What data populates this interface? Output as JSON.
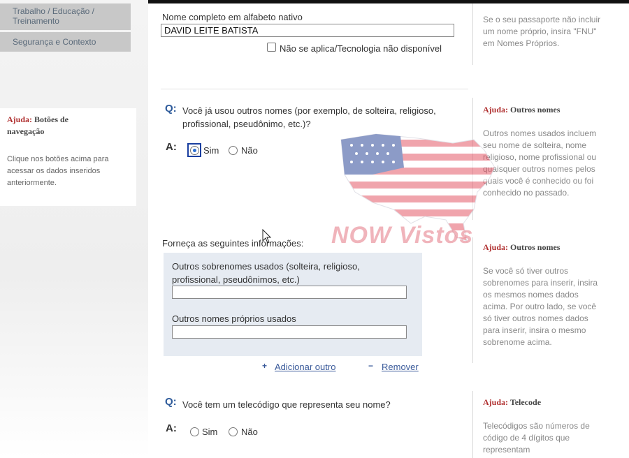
{
  "nav": {
    "items": [
      {
        "label": "Trabalho / Educação / Treinamento"
      },
      {
        "label": "Segurança e Contexto"
      }
    ]
  },
  "left_help": {
    "title_prefix": "Ajuda:",
    "title": "Botões de navegação",
    "text": "Clique nos botões acima para acessar os dados inseridos anteriormente."
  },
  "native_name": {
    "label": "Nome completo em alfabeto nativo",
    "value": "DAVID LEITE BATISTA",
    "na_label": "Não se aplica/Tecnologia não disponível"
  },
  "q_other_names": {
    "q": "Q:",
    "text": "Você já usou outros nomes (por exemplo, de solteira, religioso, profissional, pseudônimo, etc.)?",
    "a": "A:",
    "yes": "Sim",
    "no": "Não",
    "selected": "Sim"
  },
  "provide_info": {
    "label": "Forneça as seguintes informações:",
    "surnames_label": "Outros sobrenomes usados (solteira, religioso, profissional, pseudônimos, etc.)",
    "surnames_value": "",
    "given_label": "Outros nomes próprios usados",
    "given_value": "",
    "add_label": "Adicionar outro",
    "remove_label": "Remover",
    "add_icon": "+",
    "remove_icon": "−"
  },
  "q_telecode": {
    "q": "Q:",
    "text": "Você tem um telecódigo que representa seu nome?",
    "a": "A:",
    "yes": "Sim",
    "no": "Não"
  },
  "right_help": {
    "passport_text": "Se o seu passaporte não incluir um nome próprio, insira \"FNU\" em Nomes Próprios.",
    "other_names_title_prefix": "Ajuda:",
    "other_names_title": "Outros nomes",
    "other_names_text": "Outros nomes usados incluem seu nome de solteira, nome religioso, nome profissional ou quaisquer outros nomes pelos quais você é conhecido ou foi conhecido no passado.",
    "other_names2_title_prefix": "Ajuda:",
    "other_names2_title": "Outros nomes",
    "other_names2_text": "Se você só tiver outros sobrenomes para inserir, insira os mesmos nomes dados acima. Por outro lado, se você só tiver outros nomes dados para inserir, insira o mesmo sobrenome acima.",
    "telecode_title_prefix": "Ajuda:",
    "telecode_title": "Telecode",
    "telecode_text": "Telecódigos são números de código de 4 dígitos que representam"
  },
  "watermark": {
    "text": "NOW Vistos"
  },
  "colors": {
    "accent": "#2d5a9a",
    "help_title": "#b03030",
    "nav_bg": "#c8c8c8"
  }
}
